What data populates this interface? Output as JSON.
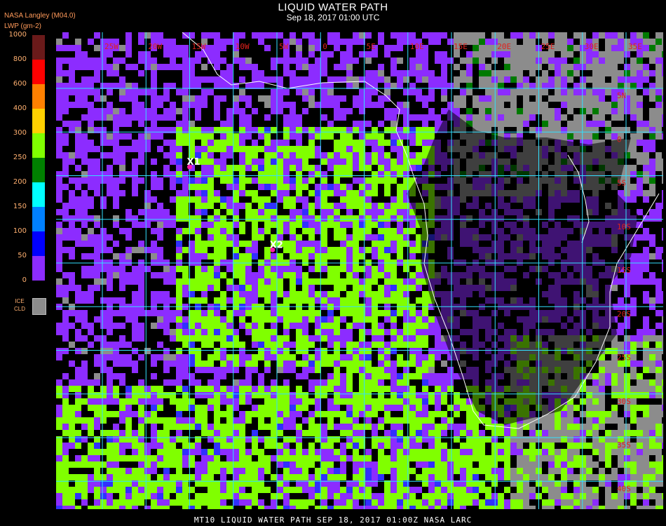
{
  "title": "LIQUID WATER PATH",
  "subtitle": "Sep 18, 2017 01:00 UTC",
  "provider": "NASA Langley (M04.0)",
  "unit": "LWP (gm-2)",
  "legend": {
    "ticks": [
      "1000",
      "800",
      "600",
      "400",
      "300",
      "250",
      "200",
      "150",
      "100",
      "50",
      "0"
    ],
    "bins": [
      {
        "color": "#6a1a1a"
      },
      {
        "color": "#ff0000"
      },
      {
        "color": "#ff8000"
      },
      {
        "color": "#ffd000"
      },
      {
        "color": "#80ff00"
      },
      {
        "color": "#008000"
      },
      {
        "color": "#00ffff"
      },
      {
        "color": "#0080ff"
      },
      {
        "color": "#0000ff"
      },
      {
        "color": "#8c2cff"
      }
    ],
    "ice_label_1": "ICE",
    "ice_label_2": "CLD",
    "ice_color": "#8c8c8c"
  },
  "map": {
    "lon_labels": [
      "25W",
      "20W",
      "15W",
      "10W",
      "5W",
      "0",
      "5E",
      "10E",
      "15E",
      "20E",
      "25E",
      "30E",
      "35E"
    ],
    "lat_labels": [
      "5N",
      "0",
      "5S",
      "10S",
      "15S",
      "20S",
      "25S",
      "30S",
      "35S",
      "40S"
    ],
    "markers": [
      {
        "label": "X1",
        "lon": -15,
        "lat": -4
      },
      {
        "label": "X2",
        "lon": -5.5,
        "lat": -13.5
      }
    ],
    "grid_color": "#33e0ff",
    "coast_color": "#ffffff"
  },
  "footer": "MT10  LIQUID WATER PATH   SEP 18, 2017 01:00Z   NASA LARC"
}
